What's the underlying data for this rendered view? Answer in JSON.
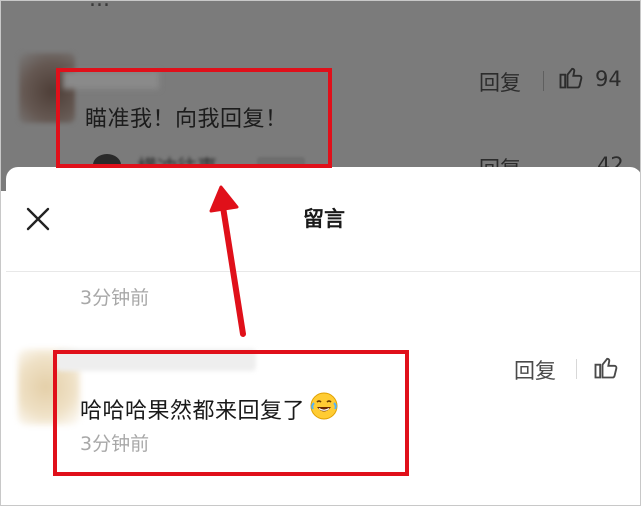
{
  "background_post": {
    "partial_text": "...",
    "comment_text": "瞄准我！向我回复！",
    "reply_label": "回复",
    "like_count": "94",
    "sub_reply_user": "横冲往事",
    "sub_reply_tag": "作者",
    "sub_reply_label": "回复",
    "sub_like_count": "42"
  },
  "sheet": {
    "title": "留言",
    "first_time": "3分钟前",
    "comment": {
      "text": "哈哈哈果然都来回复了",
      "emoji": "😂",
      "time": "3分钟前",
      "reply_label": "回复"
    }
  },
  "annotation_color": "#e0101a"
}
